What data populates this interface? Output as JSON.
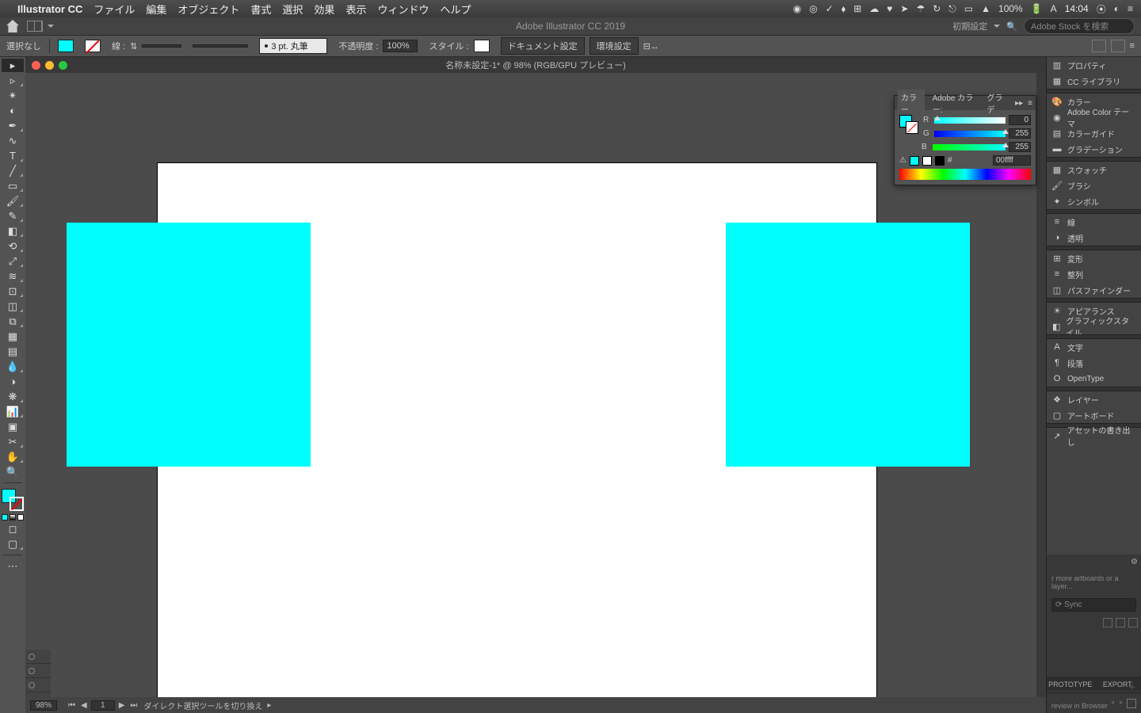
{
  "menubar": {
    "app": "Illustrator CC",
    "items": [
      "ファイル",
      "編集",
      "オブジェクト",
      "書式",
      "選択",
      "効果",
      "表示",
      "ウィンドウ",
      "ヘルプ"
    ],
    "battery": "100%",
    "clock": "14:04"
  },
  "appbar": {
    "title": "Adobe Illustrator CC 2019",
    "preset": "初期設定",
    "search_placeholder": "Adobe Stock を検索"
  },
  "control": {
    "noselect": "選択なし",
    "stroke_label": "線 :",
    "stroke_weight": "",
    "brush_label": "3 pt. 丸筆",
    "opacity_label": "不透明度 :",
    "opacity_value": "100%",
    "style_label": "スタイル :",
    "doc_setup": "ドキュメント設定",
    "env_setup": "環境設定"
  },
  "doc": {
    "tab_title": "名称未設定-1* @ 98% (RGB/GPU プレビュー)",
    "zoom": "98%",
    "artboard_num": "1",
    "status_hint": "ダイレクト選択ツールを切り換え"
  },
  "colorpanel": {
    "tab_color": "カラー",
    "tab_adobe": "Adobe  カラー:",
    "tab_grad": "グラデ",
    "r_label": "R",
    "r_value": "0",
    "g_label": "G",
    "g_value": "255",
    "b_label": "B",
    "b_value": "255",
    "hex_label": "#",
    "hex_value": "00ffff"
  },
  "rightdock": {
    "properties": "プロパティ",
    "cc_library": "CC ライブラリ",
    "color": "カラー",
    "adobe_color": "Adobe Color テーマ",
    "color_guide": "カラーガイド",
    "gradation": "グラデーション",
    "swatches": "スウォッチ",
    "brushes": "ブラシ",
    "symbols": "シンボル",
    "stroke": "線",
    "transparency": "透明",
    "transform": "変形",
    "align": "整列",
    "pathfinder": "パスファインダー",
    "appearance": "アピアランス",
    "graphic_styles": "グラフィックスタイル",
    "text": "文字",
    "paragraph": "段落",
    "opentype": "OpenType",
    "layers": "レイヤー",
    "artboards": "アートボード",
    "asset_export": "アセットの書き出し"
  },
  "ext": {
    "hint": "r more artboards or a layer...",
    "sync": "Sync",
    "tab_proto": "PROTOTYPE",
    "tab_export": "EXPORT",
    "preview": "review in Browser"
  },
  "canvas_shapes": {
    "fill_color": "#00fefe",
    "artboard_bg": "#ffffff"
  }
}
